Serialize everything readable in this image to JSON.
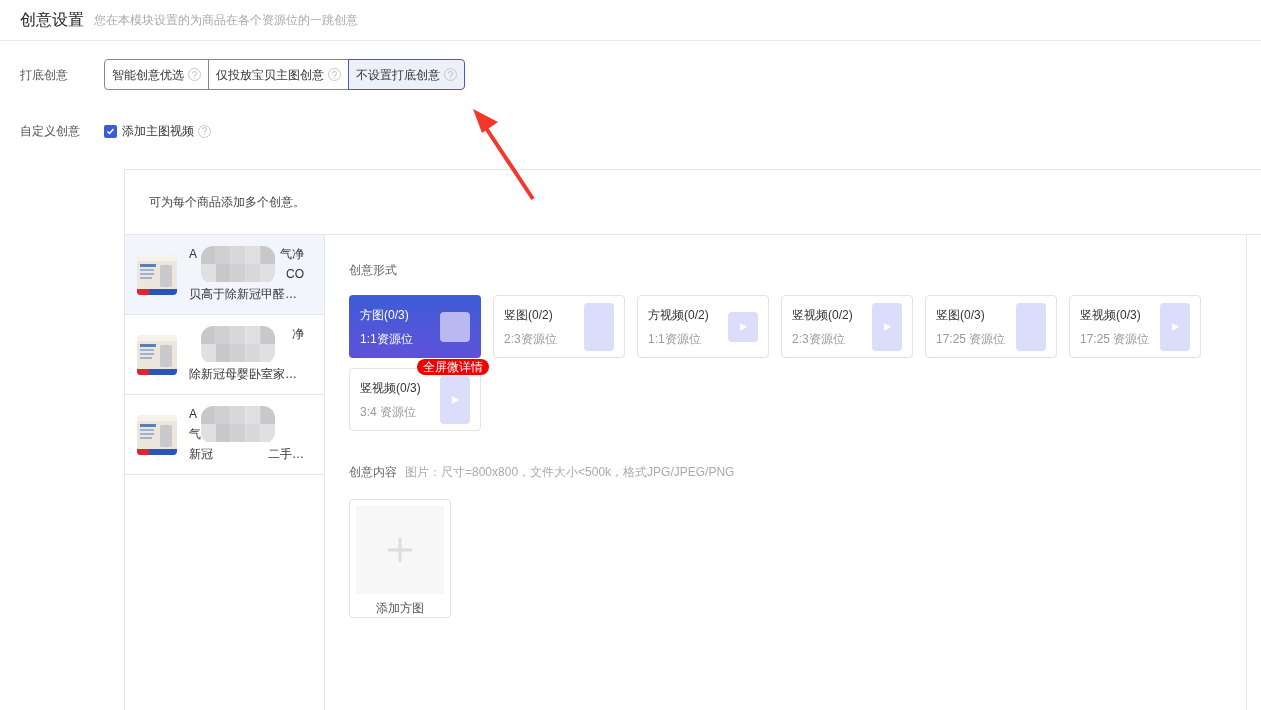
{
  "header": {
    "title": "创意设置",
    "subtitle": "您在本模块设置的为商品在各个资源位的一跳创意"
  },
  "fallback": {
    "label": "打底创意",
    "options": [
      {
        "label": "智能创意优选",
        "selected": false
      },
      {
        "label": "仅投放宝贝主图创意",
        "selected": false
      },
      {
        "label": "不设置打底创意",
        "selected": true
      }
    ]
  },
  "custom": {
    "label": "自定义创意",
    "checkbox": {
      "label": "添加主图视频",
      "checked": true
    }
  },
  "panel": {
    "note": "可为每个商品添加多个创意。",
    "products": [
      {
        "selected": true,
        "lines": [
          {
            "left": "A",
            "right": "气净"
          },
          {
            "right": "CO"
          },
          {
            "left": "贝高于除新冠甲醛…"
          }
        ]
      },
      {
        "selected": false,
        "lines": [
          {
            "right": "净"
          },
          {
            "left": "除新冠母婴卧室家…"
          }
        ]
      },
      {
        "selected": false,
        "lines": [
          {
            "left": "A"
          },
          {
            "left": "气"
          },
          {
            "left": "新冠",
            "right": "二手…"
          }
        ]
      }
    ],
    "format_label": "创意形式",
    "formats": [
      {
        "kind": "squareimage",
        "title": "方图(0/3)",
        "ratio": "1:1资源位",
        "selected": true
      },
      {
        "kind": "tallimage",
        "title": "竖图(0/2)",
        "ratio": "2:3资源位",
        "selected": false
      },
      {
        "kind": "squarevideo",
        "title": "方视频(0/2)",
        "ratio": "1:1资源位",
        "selected": false
      },
      {
        "kind": "tallvideo",
        "title": "竖视频(0/2)",
        "ratio": "2:3资源位",
        "selected": false
      },
      {
        "kind": "tallimage",
        "title": "竖图(0/3)",
        "ratio": "17:25 资源位",
        "selected": false
      },
      {
        "kind": "tallvideo",
        "title": "竖视频(0/3)",
        "ratio": "17:25 资源位",
        "selected": false
      },
      {
        "kind": "tallvideo",
        "title": "竖视频(0/3)",
        "ratio": "3:4 资源位",
        "selected": false,
        "badge": "全屏微详情"
      }
    ],
    "content_label": "创意内容",
    "content_hint": "图片：尺寸=800x800，文件大小<500k，格式JPG/JPEG/PNG",
    "upload": {
      "label": "添加方图"
    }
  }
}
